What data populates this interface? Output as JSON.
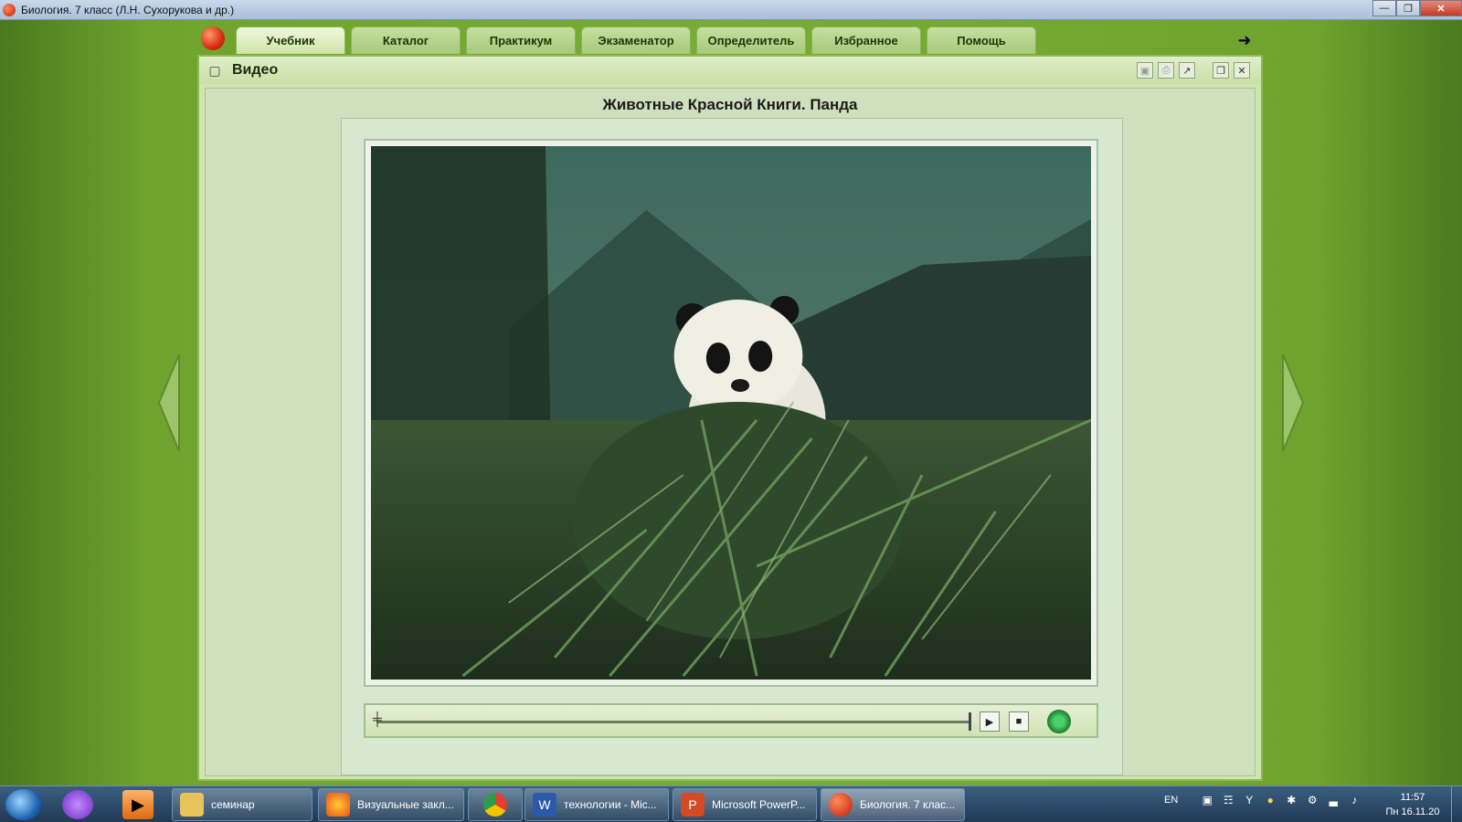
{
  "window": {
    "title": "Биология. 7 класс (Л.Н. Сухорукова и др.)",
    "buttons": [
      "minimize",
      "restore",
      "close"
    ]
  },
  "tabs": [
    {
      "label": "Учебник",
      "active": true
    },
    {
      "label": "Каталог",
      "active": false
    },
    {
      "label": "Практикум",
      "active": false
    },
    {
      "label": "Экзаменатор",
      "active": false
    },
    {
      "label": "Определитель",
      "active": false
    },
    {
      "label": "Избранное",
      "active": false
    },
    {
      "label": "Помощь",
      "active": false
    }
  ],
  "panel": {
    "title": "Видео",
    "video_title": "Животные Красной Книги. Панда",
    "tools": [
      "save-icon",
      "print-icon",
      "export-icon",
      "restore-window-icon",
      "close-icon"
    ]
  },
  "player": {
    "progress": 0.0,
    "buttons": [
      "play",
      "stop",
      "volume"
    ]
  },
  "taskbar": {
    "items": [
      {
        "label": "семинар",
        "icon": "folder-icon"
      },
      {
        "label": "Визуальные закл...",
        "icon": "firefox-icon"
      },
      {
        "label": "",
        "icon": "chrome-icon"
      },
      {
        "label": "технологии - Mic...",
        "icon": "word-icon"
      },
      {
        "label": "Microsoft PowerP...",
        "icon": "powerpoint-icon"
      },
      {
        "label": "Биология. 7 клас...",
        "icon": "biology-app-icon",
        "active": true
      }
    ],
    "lang": "EN",
    "time": "11:57",
    "date": "Пн 16.11.20"
  },
  "colors": {
    "background_green": "#78ad34",
    "tab_active": "#eef7dc",
    "panel": "#cfe5b0"
  }
}
